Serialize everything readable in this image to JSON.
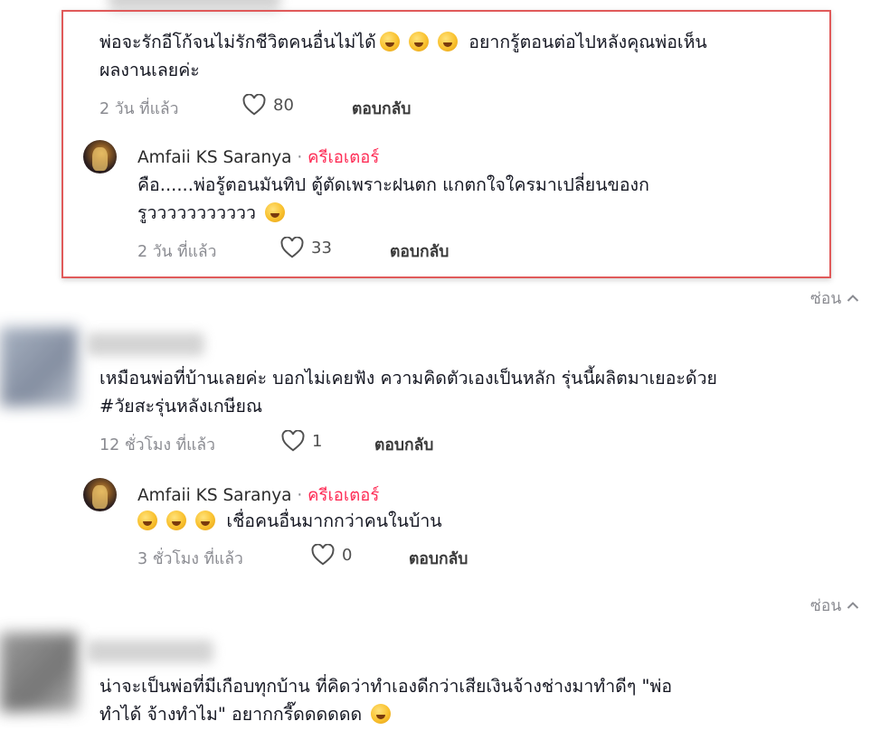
{
  "comments": [
    {
      "text_line1": "พ่อจะรักอีโก้จนไม่รักชีวิตคนอื่นไม่ได้",
      "text_line1_tail": "อยากรู้ตอนต่อไปหลังคุณพ่อเห็น",
      "text_line2": "ผลงานเลยค่ะ",
      "time": "2 วัน ที่แล้ว",
      "likes": "80",
      "reply_label": "ตอบกลับ",
      "emoji_icon": "rolling-on-floor-laughing-icon",
      "reply": {
        "author": "Amfaii KS Saranya",
        "separator": "·",
        "badge": "ครีเอเตอร์",
        "text_line1": "คือ......พ่อรู้ตอนมันทิป ตู้ตัดเพราะฝนตก แกตกใจใครมาเปลี่ยนของก",
        "text_line2": "รูววววววววววว",
        "time": "2 วัน ที่แล้ว",
        "likes": "33",
        "reply_label": "ตอบกลับ"
      }
    },
    {
      "text_line1": "เหมือนพ่อที่บ้านเลยค่ะ บอกไม่เคยฟัง ความคิดตัวเองเป็นหลัก รุ่นนี้ผลิตมาเยอะด้วย",
      "text_line2": "#วัยสะรุ่นหลังเกษียณ",
      "time": "12 ชั่วโมง ที่แล้ว",
      "likes": "1",
      "reply_label": "ตอบกลับ",
      "reply": {
        "author": "Amfaii KS Saranya",
        "separator": "·",
        "badge": "ครีเอเตอร์",
        "text_line1": "เชื่อคนอื่นมากกว่าคนในบ้าน",
        "time": "3 ชั่วโมง ที่แล้ว",
        "likes": "0",
        "reply_label": "ตอบกลับ"
      }
    },
    {
      "text_line1": "น่าจะเป็นพ่อที่มีเกือบทุกบ้าน ที่คิดว่าทำเองดีกว่าเสียเงินจ้างช่างมาทำดีๆ \"พ่อ",
      "text_line2": "ทำได้ จ้างทำไม\" อยากกรี๊ดดดดดด"
    }
  ],
  "hide_label": "ซ่อน",
  "colors": {
    "creator_badge": "#fe2c55",
    "highlight_border": "#e05a5a"
  }
}
